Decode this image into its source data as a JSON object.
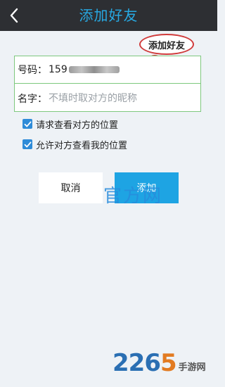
{
  "header": {
    "title": "添加好友",
    "back_icon": "chevron-left-icon"
  },
  "bubble_label": "添加好友",
  "form": {
    "phone_label": "号码：",
    "phone_value": "159",
    "name_label": "名字：",
    "name_placeholder": "不填时取对方的昵称"
  },
  "options": [
    {
      "label": "请求查看对方的位置",
      "checked": true
    },
    {
      "label": "允许对方查看我的位置",
      "checked": true
    }
  ],
  "buttons": {
    "cancel": "取消",
    "add": "添加"
  },
  "watermark": {
    "center_text": "官方网",
    "logo_number_a": "226",
    "logo_number_b": "5",
    "logo_text": "手游网"
  },
  "colors": {
    "title": "#27a9e3",
    "topbar": "#2d2f33",
    "add_button": "#1ea4e3",
    "checkbox": "#2e8bd8",
    "field_border": "#7ec87e"
  }
}
